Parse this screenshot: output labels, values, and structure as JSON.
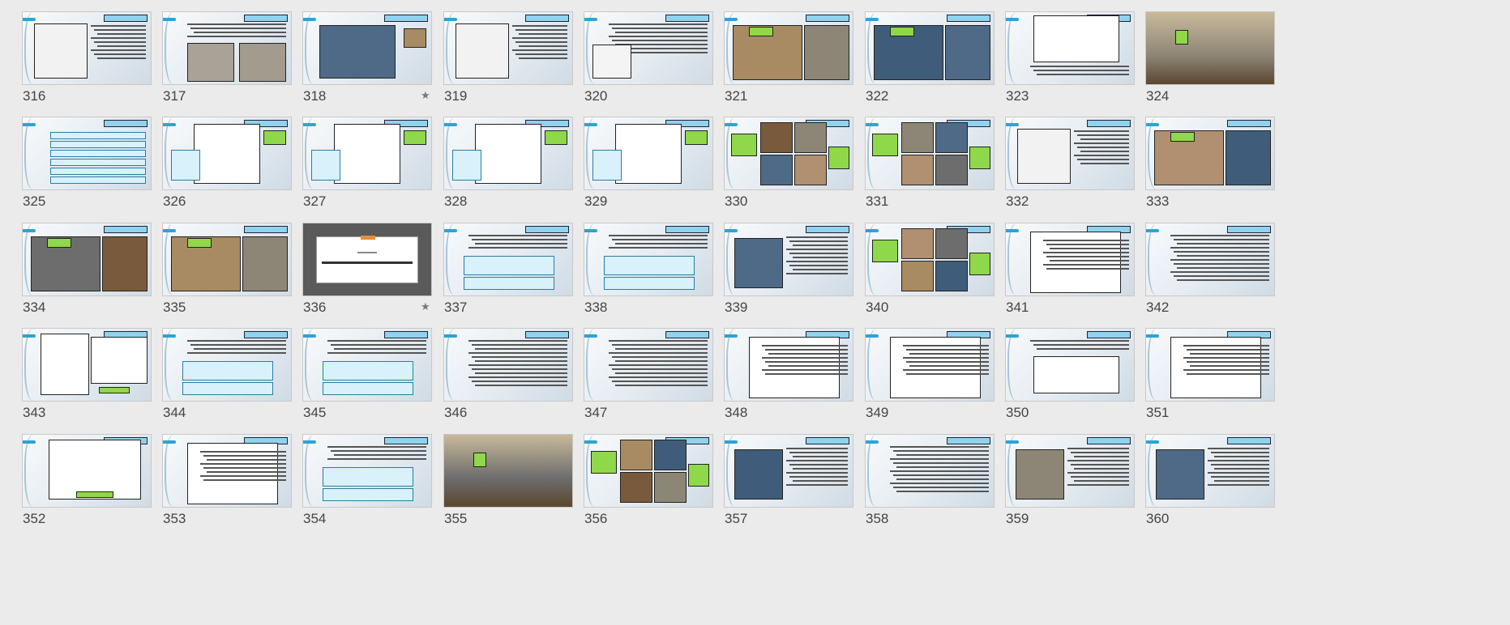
{
  "slide_sorter": {
    "slides": [
      {
        "number": "316",
        "type": "image-text",
        "starred": false
      },
      {
        "number": "317",
        "type": "text-two-images",
        "starred": false
      },
      {
        "number": "318",
        "type": "photo-detail",
        "starred": true
      },
      {
        "number": "319",
        "type": "image-text",
        "starred": false
      },
      {
        "number": "320",
        "type": "text-diagram",
        "starred": false
      },
      {
        "number": "321",
        "type": "two-photos",
        "starred": false
      },
      {
        "number": "322",
        "type": "two-photos",
        "starred": false
      },
      {
        "number": "323",
        "type": "sketch",
        "starred": false
      },
      {
        "number": "324",
        "type": "full-photo",
        "starred": false
      },
      {
        "number": "325",
        "type": "list-boxes",
        "starred": false
      },
      {
        "number": "326",
        "type": "diagram-text",
        "starred": false
      },
      {
        "number": "327",
        "type": "diagram-text",
        "starred": false
      },
      {
        "number": "328",
        "type": "diagram-text",
        "starred": false
      },
      {
        "number": "329",
        "type": "diagram-text",
        "starred": false
      },
      {
        "number": "330",
        "type": "photo-grid",
        "starred": false
      },
      {
        "number": "331",
        "type": "photo-grid",
        "starred": false
      },
      {
        "number": "332",
        "type": "image-text",
        "starred": false
      },
      {
        "number": "333",
        "type": "two-photos",
        "starred": false
      },
      {
        "number": "334",
        "type": "two-photos",
        "starred": false
      },
      {
        "number": "335",
        "type": "two-photos",
        "starred": false
      },
      {
        "number": "336",
        "type": "section-title",
        "starred": true,
        "section_label": "پخش ششم",
        "section_title": "ویژگی های گرمایی عناصر و مصالح ساختمانی"
      },
      {
        "number": "337",
        "type": "text-boxes",
        "starred": false
      },
      {
        "number": "338",
        "type": "text-boxes",
        "starred": false
      },
      {
        "number": "339",
        "type": "photo-text",
        "starred": false
      },
      {
        "number": "340",
        "type": "photo-grid",
        "starred": false
      },
      {
        "number": "341",
        "type": "table",
        "starred": false
      },
      {
        "number": "342",
        "type": "text",
        "starred": false
      },
      {
        "number": "343",
        "type": "table-diagram",
        "starred": false
      },
      {
        "number": "344",
        "type": "text-boxes",
        "starred": false
      },
      {
        "number": "345",
        "type": "text-boxes",
        "starred": false
      },
      {
        "number": "346",
        "type": "text",
        "starred": false
      },
      {
        "number": "347",
        "type": "text",
        "starred": false
      },
      {
        "number": "348",
        "type": "table",
        "starred": false
      },
      {
        "number": "349",
        "type": "table",
        "starred": false
      },
      {
        "number": "350",
        "type": "diagram",
        "starred": false
      },
      {
        "number": "351",
        "type": "table",
        "starred": false
      },
      {
        "number": "352",
        "type": "chart",
        "starred": false
      },
      {
        "number": "353",
        "type": "table",
        "starred": false
      },
      {
        "number": "354",
        "type": "text-boxes",
        "starred": false
      },
      {
        "number": "355",
        "type": "full-photo",
        "starred": false
      },
      {
        "number": "356",
        "type": "photo-grid",
        "starred": false
      },
      {
        "number": "357",
        "type": "photo-text",
        "starred": false
      },
      {
        "number": "358",
        "type": "text",
        "starred": false
      },
      {
        "number": "359",
        "type": "photo-text",
        "starred": false
      },
      {
        "number": "360",
        "type": "photo-text",
        "starred": false
      }
    ],
    "star_glyph": "★",
    "colors": {
      "background": "#ebebeb",
      "accent_blue": "#2ea3d5",
      "highlight_green": "#8fd84a",
      "title_box": "#8fd3ee",
      "section_slide": "#5a5a5a",
      "section_tab": "#e98b3a"
    }
  }
}
